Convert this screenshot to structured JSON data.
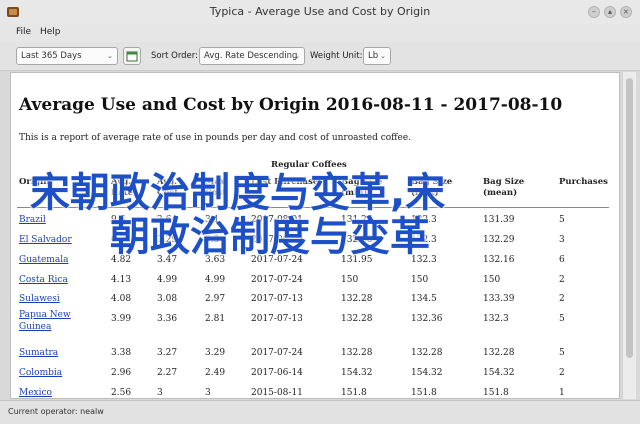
{
  "window": {
    "title": "Typica - Average Use and Cost by Origin"
  },
  "menu": {
    "items": [
      "File",
      "Help"
    ]
  },
  "toolbar": {
    "date_range": "Last 365 Days",
    "sort_order_label": "Sort Order:",
    "sort_order_value": "Avg. Rate Descending",
    "weight_unit_label": "Weight Unit:",
    "weight_unit_value": "Lb"
  },
  "report": {
    "title": "Average Use and Cost by Origin 2016-08-11 - 2017-08-10",
    "description": "This is a report of average rate of use in pounds per day and cost of unroasted coffee.",
    "group_header": "Regular Coffees",
    "columns": [
      [
        "Origin"
      ],
      [
        "Avg.",
        "Rate"
      ],
      [
        "Avg.",
        "Cost"
      ],
      [
        "Max",
        "Cost"
      ],
      [
        "Last Purchase"
      ],
      [
        "Bag Size",
        "(min)"
      ],
      [
        "Bag Size",
        "(max)"
      ],
      [
        "Bag Size",
        "(mean)"
      ],
      [
        "Purchases"
      ]
    ],
    "rows": [
      [
        "Brazil",
        "9.6",
        "2.64",
        "3.1",
        "2017-08-01",
        "131.25",
        "132.3",
        "131.39",
        "5"
      ],
      [
        "El Salvador",
        "6.22",
        "3.29",
        "3.3",
        "2017-06-09",
        "132.28",
        "132.3",
        "132.29",
        "3"
      ],
      [
        "Guatemala",
        "4.82",
        "3.47",
        "3.63",
        "2017-07-24",
        "131.95",
        "132.3",
        "132.16",
        "6"
      ],
      [
        "Costa Rica",
        "4.13",
        "4.99",
        "4.99",
        "2017-07-24",
        "150",
        "150",
        "150",
        "2"
      ],
      [
        "Sulawesi",
        "4.08",
        "3.08",
        "2.97",
        "2017-07-13",
        "132.28",
        "134.5",
        "133.39",
        "2"
      ],
      [
        "Papua New Guinea",
        "3.99",
        "3.36",
        "2.81",
        "2017-07-13",
        "132.28",
        "132.36",
        "132.3",
        "5"
      ],
      [
        "Sumatra",
        "3.38",
        "3.27",
        "3.29",
        "2017-07-24",
        "132.28",
        "132.28",
        "132.28",
        "5"
      ],
      [
        "Colombia",
        "2.96",
        "2.27",
        "2.49",
        "2017-06-14",
        "154.32",
        "154.32",
        "154.32",
        "2"
      ],
      [
        "Mexico",
        "2.56",
        "3",
        "3",
        "2015-08-11",
        "151.8",
        "151.8",
        "151.8",
        "1"
      ]
    ]
  },
  "overlay": {
    "line1": "宋朝政治制度与变革,宋",
    "line2": "朝政治制度与变革"
  },
  "status": {
    "text": "Current operator: nealw"
  },
  "colors": {
    "link": "#1b3fb5",
    "overlay_text": "#1d4fc7"
  }
}
